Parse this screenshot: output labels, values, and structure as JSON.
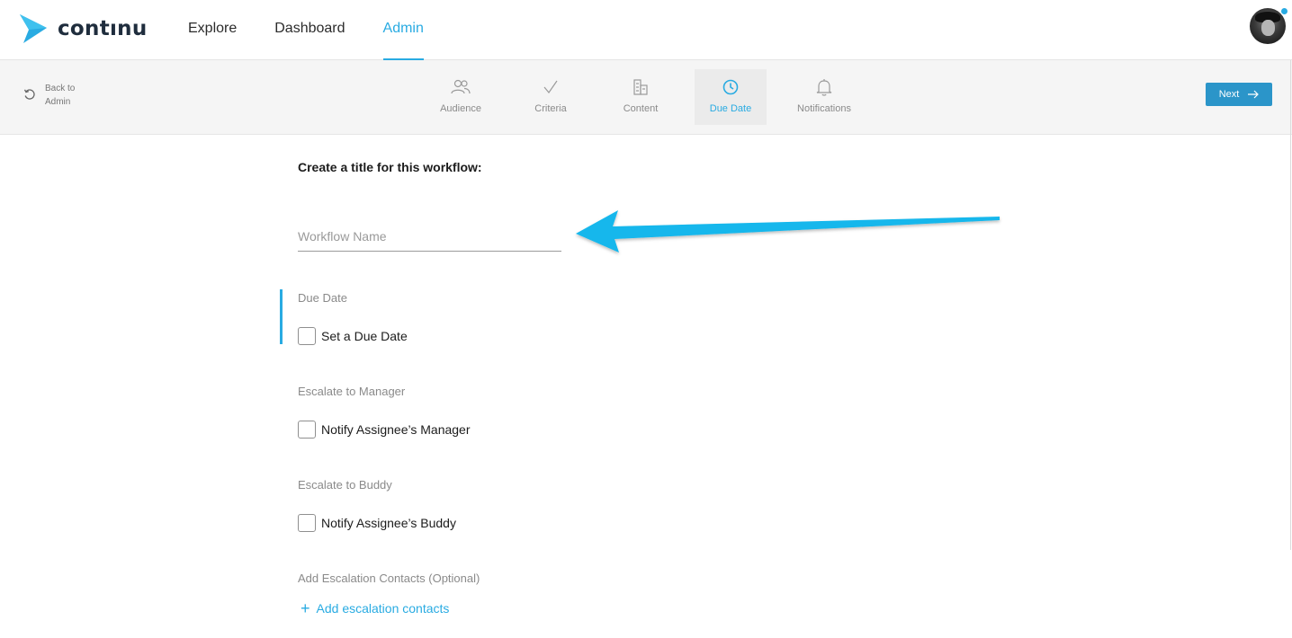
{
  "brand": {
    "name": "contınu",
    "accent": "#29abe2"
  },
  "nav": {
    "items": [
      {
        "label": "Explore"
      },
      {
        "label": "Dashboard"
      },
      {
        "label": "Admin",
        "active": true
      }
    ]
  },
  "stepbar": {
    "back_line1": "Back to",
    "back_line2": "Admin",
    "steps": [
      {
        "label": "Audience",
        "icon": "users-icon"
      },
      {
        "label": "Criteria",
        "icon": "check-icon"
      },
      {
        "label": "Content",
        "icon": "building-icon"
      },
      {
        "label": "Due Date",
        "icon": "clock-icon",
        "active": true
      },
      {
        "label": "Notifications",
        "icon": "bell-icon"
      }
    ],
    "next_label": "Next"
  },
  "form": {
    "title": "Create a title for this workflow:",
    "name_placeholder": "Workflow Name",
    "name_value": "",
    "due_date": {
      "section": "Due Date",
      "checkbox": "Set a Due Date",
      "checked": false
    },
    "escalate_manager": {
      "section": "Escalate to Manager",
      "checkbox": "Notify Assignee’s Manager",
      "checked": false
    },
    "escalate_buddy": {
      "section": "Escalate to Buddy",
      "checkbox": "Notify Assignee’s Buddy",
      "checked": false
    },
    "contacts": {
      "section": "Add Escalation Contacts (Optional)",
      "link": "Add escalation contacts"
    }
  }
}
